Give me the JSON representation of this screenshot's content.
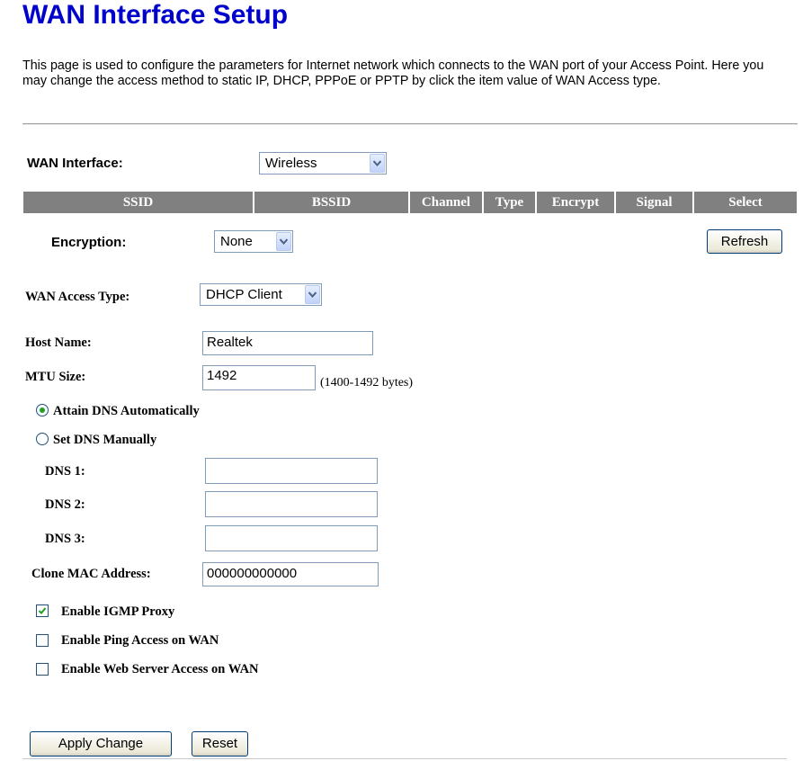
{
  "page": {
    "title": "WAN Interface Setup",
    "description": "This page is used to configure the parameters for Internet network which connects to the WAN port of your Access Point. Here you may change the access method to static IP, DHCP, PPPoE or PPTP by click the item value of WAN Access type."
  },
  "wan_interface": {
    "label": "WAN Interface:",
    "value": "Wireless"
  },
  "site_table": {
    "headers": [
      "SSID",
      "BSSID",
      "Channel",
      "Type",
      "Encrypt",
      "Signal",
      "Select"
    ]
  },
  "encryption": {
    "label": "Encryption:",
    "value": "None",
    "refresh_label": "Refresh"
  },
  "wan_access": {
    "label": "WAN Access Type:",
    "value": "DHCP Client"
  },
  "host_name": {
    "label": "Host Name:",
    "value": "Realtek"
  },
  "mtu": {
    "label": "MTU Size:",
    "value": "1492",
    "hint": "(1400-1492 bytes)"
  },
  "dns": {
    "auto_label": "Attain DNS Automatically",
    "manual_label": "Set DNS Manually",
    "auto_selected": true,
    "dns1_label": "DNS 1:",
    "dns1_value": "",
    "dns2_label": "DNS 2:",
    "dns2_value": "",
    "dns3_label": "DNS 3:",
    "dns3_value": ""
  },
  "clone_mac": {
    "label": "Clone MAC Address:",
    "value": "000000000000"
  },
  "options": {
    "igmp_label": "Enable IGMP Proxy",
    "igmp_checked": true,
    "ping_label": "Enable Ping Access on WAN",
    "ping_checked": false,
    "web_label": "Enable Web Server Access on WAN",
    "web_checked": false
  },
  "actions": {
    "apply_label": "Apply Change",
    "reset_label": "Reset"
  },
  "icons": {
    "dropdown": "chevron-down-icon",
    "radio_selected": "radio-selected-icon",
    "radio_unselected": "radio-unselected-icon",
    "checkbox_checked": "checkbox-checked-icon",
    "checkbox_unchecked": "checkbox-unchecked-icon"
  },
  "colors": {
    "title": "#0000cc",
    "table_header_bg": "#808080",
    "radio_dot": "#21a121",
    "check_mark": "#21a121"
  }
}
